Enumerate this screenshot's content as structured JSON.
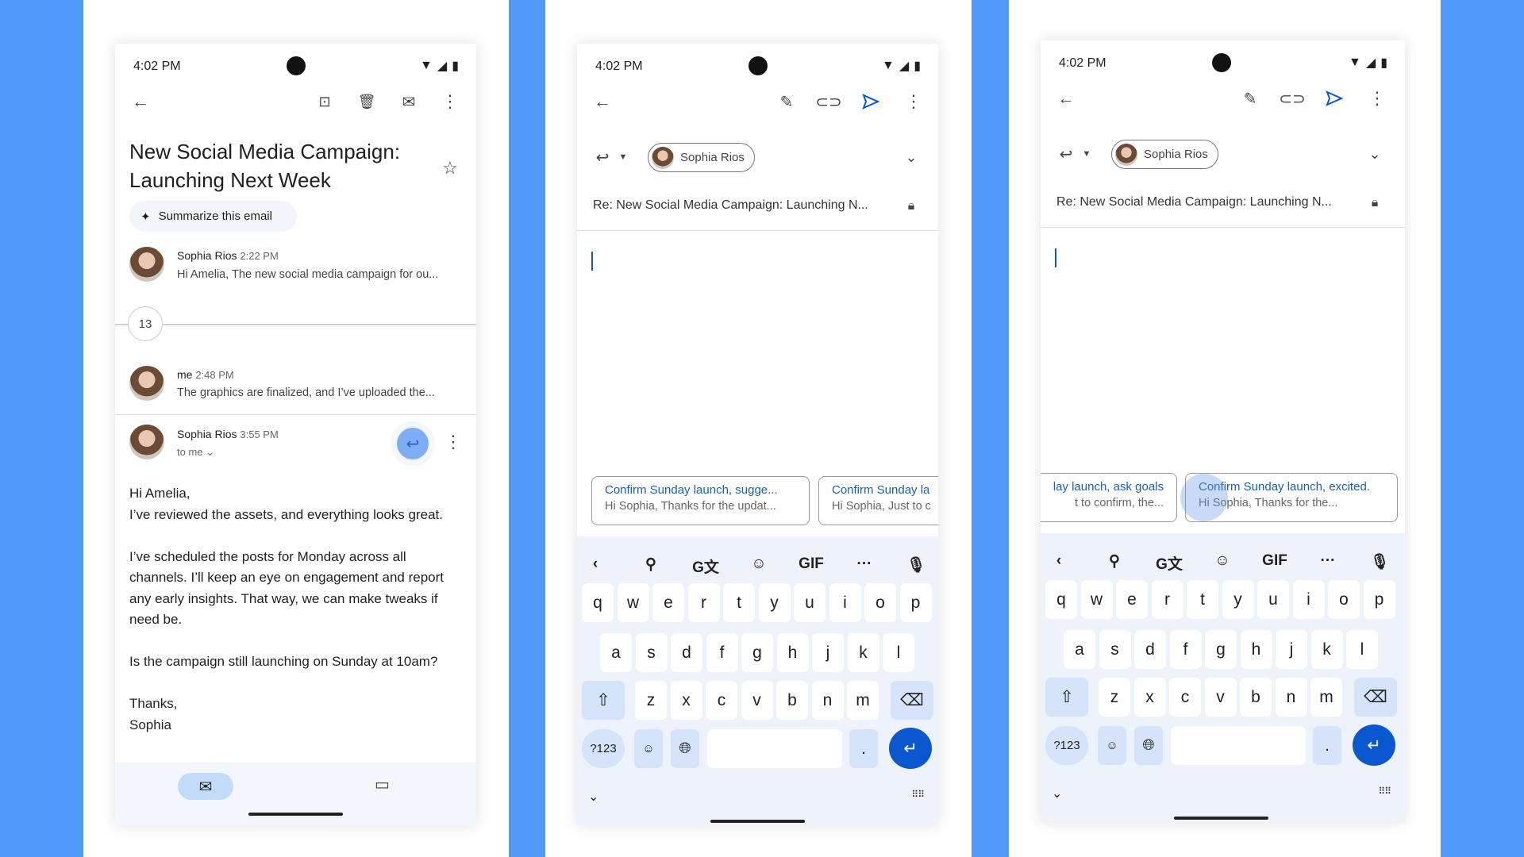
{
  "colors": {
    "background": "#5298f6",
    "accent": "#0b57d0",
    "suggestion_text": "#1a5fb4"
  },
  "status_time": "4:02 PM",
  "phone1": {
    "title": "New Social Media Campaign: Launching Next Week",
    "summarize": "Summarize this email",
    "messages": [
      {
        "name": "Sophia Rios",
        "time": "2:22 PM",
        "preview": "Hi Amelia, The new social media campaign for ou..."
      },
      {
        "name": "me",
        "time": "2:48 PM",
        "preview": "The graphics are finalized, and I’ve uploaded the..."
      },
      {
        "name": "Sophia Rios",
        "time": "3:55 PM",
        "recipient": "to me"
      }
    ],
    "collapsed_count": "13",
    "body": {
      "greeting": "Hi Amelia,",
      "p1": "I’ve reviewed the assets, and everything looks great.",
      "p2": "I’ve scheduled the posts for Monday across all channels. I’ll keep an eye on engagement and report any early insights. That way, we can make tweaks if need be.",
      "p3": "Is the campaign still launching on Sunday at 10am?",
      "closing": "Thanks,",
      "signature": "Sophia"
    }
  },
  "compose": {
    "recipient": "Sophia Rios",
    "subject": "Re: New Social Media Campaign: Launching N..."
  },
  "phone2": {
    "suggestions": [
      {
        "title": "Confirm Sunday launch, sugge...",
        "preview": "Hi Sophia, Thanks for the updat..."
      },
      {
        "title": "Confirm Sunday la",
        "preview": "Hi Sophia, Just to c"
      }
    ]
  },
  "phone3": {
    "suggestions": [
      {
        "title": "lay launch, ask goals",
        "preview": "t to confirm, the..."
      },
      {
        "title": "Confirm Sunday launch, excited.",
        "preview": "Hi Sophia, Thanks for the..."
      }
    ]
  },
  "keyboard": {
    "toolbar": [
      "‹",
      "search-icon",
      "translate-icon",
      "sticker-icon",
      "GIF",
      "···",
      "mic-icon"
    ],
    "row1": [
      "q",
      "w",
      "e",
      "r",
      "t",
      "y",
      "u",
      "i",
      "o",
      "p"
    ],
    "row2": [
      "a",
      "s",
      "d",
      "f",
      "g",
      "h",
      "j",
      "k",
      "l"
    ],
    "row3": [
      "z",
      "x",
      "c",
      "v",
      "b",
      "n",
      "m"
    ],
    "symbols": "?123",
    "period": "."
  }
}
